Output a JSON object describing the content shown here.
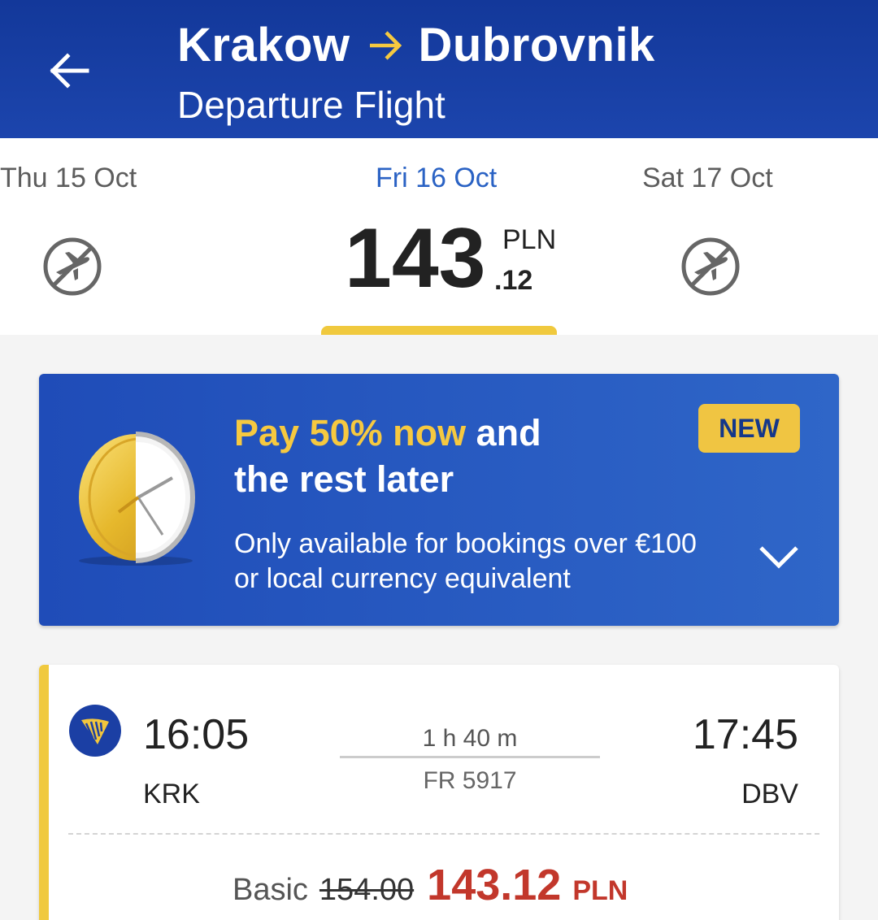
{
  "header": {
    "origin": "Krakow",
    "destination": "Dubrovnik",
    "subtitle": "Departure Flight"
  },
  "date_selector": {
    "previous": {
      "label": "Thu 15 Oct",
      "status_icon": "no-flights-icon"
    },
    "selected": {
      "label": "Fri 16 Oct",
      "price_int": "143",
      "price_dec": ".12",
      "currency": "PLN"
    },
    "next": {
      "label": "Sat 17 Oct",
      "status_icon": "no-flights-icon"
    }
  },
  "promo": {
    "title_highlight": "Pay 50% now",
    "title_rest": " and",
    "title_line2": "the rest later",
    "badge": "NEW",
    "desc_line1": "Only available for bookings over €100",
    "desc_line2": "or local currency equivalent"
  },
  "flight": {
    "departure_time": "16:05",
    "departure_code": "KRK",
    "arrival_time": "17:45",
    "arrival_code": "DBV",
    "duration": "1 h 40 m",
    "flight_number": "FR 5917",
    "fare_label": "Basic",
    "old_price": "154.00",
    "new_price": "143.12",
    "currency": "PLN"
  },
  "colors": {
    "header": "#1c45ad",
    "accent_yellow": "#f0c93e",
    "active_date": "#2a62c4",
    "sale_price": "#c2372b"
  }
}
